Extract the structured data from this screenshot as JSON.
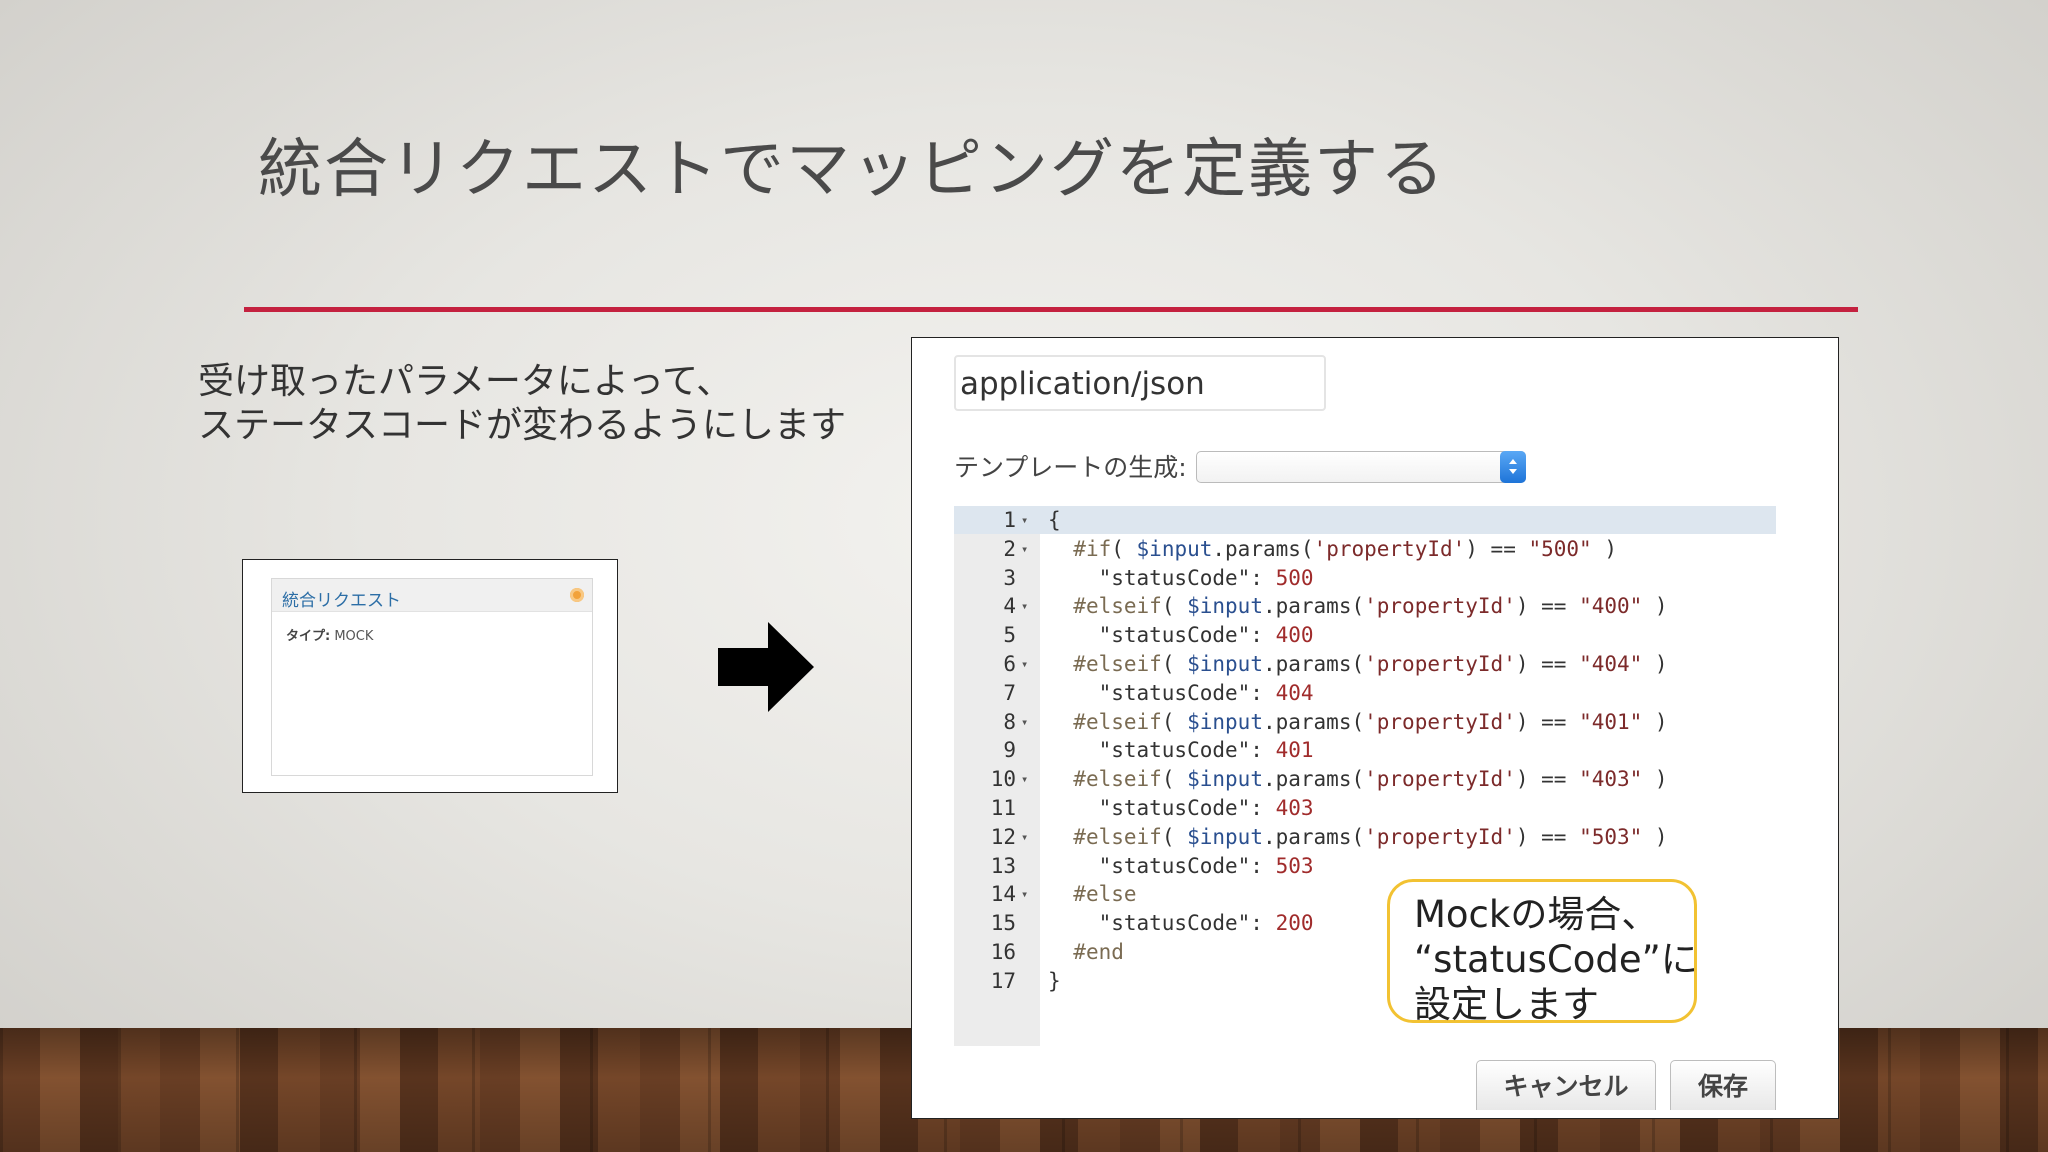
{
  "slide": {
    "title": "統合リクエストでマッピングを定義する",
    "description_lines": [
      "受け取ったパラメータによって、",
      "ステータスコードが変わるようにします"
    ],
    "accent_color": "#c4213f"
  },
  "thumbnail": {
    "header": "統合リクエスト",
    "type_label": "タイプ:",
    "type_value": "MOCK"
  },
  "dialog": {
    "content_type": "application/json",
    "template_generation_label": "テンプレートの生成:",
    "template_generation_value": "",
    "code_lines": [
      {
        "n": "1",
        "fold": true,
        "text": "{"
      },
      {
        "n": "2",
        "fold": true,
        "text": "  #if( $input.params('propertyId') == \"500\" )"
      },
      {
        "n": "3",
        "fold": false,
        "text": "    \"statusCode\": 500"
      },
      {
        "n": "4",
        "fold": true,
        "text": "  #elseif( $input.params('propertyId') == \"400\" )"
      },
      {
        "n": "5",
        "fold": false,
        "text": "    \"statusCode\": 400"
      },
      {
        "n": "6",
        "fold": true,
        "text": "  #elseif( $input.params('propertyId') == \"404\" )"
      },
      {
        "n": "7",
        "fold": false,
        "text": "    \"statusCode\": 404"
      },
      {
        "n": "8",
        "fold": true,
        "text": "  #elseif( $input.params('propertyId') == \"401\" )"
      },
      {
        "n": "9",
        "fold": false,
        "text": "    \"statusCode\": 401"
      },
      {
        "n": "10",
        "fold": true,
        "text": "  #elseif( $input.params('propertyId') == \"403\" )"
      },
      {
        "n": "11",
        "fold": false,
        "text": "    \"statusCode\": 403"
      },
      {
        "n": "12",
        "fold": true,
        "text": "  #elseif( $input.params('propertyId') == \"503\" )"
      },
      {
        "n": "13",
        "fold": false,
        "text": "    \"statusCode\": 503"
      },
      {
        "n": "14",
        "fold": true,
        "text": "  #else"
      },
      {
        "n": "15",
        "fold": false,
        "text": "    \"statusCode\": 200"
      },
      {
        "n": "16",
        "fold": false,
        "text": "  #end"
      },
      {
        "n": "17",
        "fold": false,
        "text": "}"
      }
    ],
    "callout_lines": [
      "Mockの場合、",
      "“statusCode”に",
      "設定します"
    ],
    "cancel_label": "キャンセル",
    "save_label": "保存",
    "callout_border_color": "#f2c232",
    "select_button_color": "#1e74d8"
  },
  "icons": {
    "arrow": "arrow-right-icon",
    "resize": "resize-diagonal-icon",
    "fold": "fold-caret-icon",
    "status_dot": "status-dot-icon"
  }
}
